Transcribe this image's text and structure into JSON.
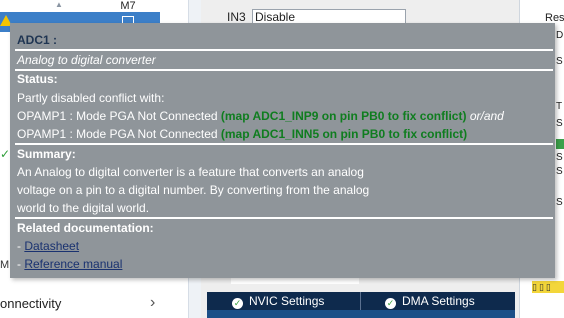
{
  "background": {
    "left_panel": {
      "column_header": "M7",
      "selected_item": "ADC1",
      "side_label": "M",
      "connectivity_label": "onnectivity"
    },
    "center_panel": {
      "in3_label": "IN3",
      "in3_value": "Disable"
    },
    "tabs": {
      "nvic_label": "NVIC Settings",
      "dma_label": "DMA Settings"
    },
    "right_panel": {
      "res_label": "Res",
      "fragments": [
        "D",
        "S",
        "T",
        "S",
        "S",
        "S",
        "S"
      ]
    }
  },
  "tooltip": {
    "title": "ADC1 :",
    "subtitle": "Analog to digital converter",
    "status_heading": "Status:",
    "status_intro": "Partly disabled conflict with:",
    "conflict1_prefix": "OPAMP1 : Mode PGA Not Connected",
    "conflict1_fix": "(map ADC1_INP9 on pin PB0 to fix conflict)",
    "conflict1_suffix": "or/and",
    "conflict2_prefix": "OPAMP1 : Mode PGA Not Connected",
    "conflict2_fix": "(map ADC1_INN5 on pin PB0 to fix conflict)",
    "summary_heading": "Summary:",
    "summary_line1": "An Analog to digital converter is a feature that converts an analog",
    "summary_line2": "voltage on a pin to a digital number. By converting from the analog",
    "summary_line3": "world to the digital world.",
    "docs_heading": "Related documentation:",
    "doc_bullet": "-",
    "doc1": "Datasheet",
    "doc2": "Reference manual"
  },
  "colors": {
    "tooltip_bg": "#8f959a",
    "fix_hint_green": "#0f7d1f",
    "selected_row": "#3c7fc8",
    "tab_bar": "#0e2a4d"
  }
}
